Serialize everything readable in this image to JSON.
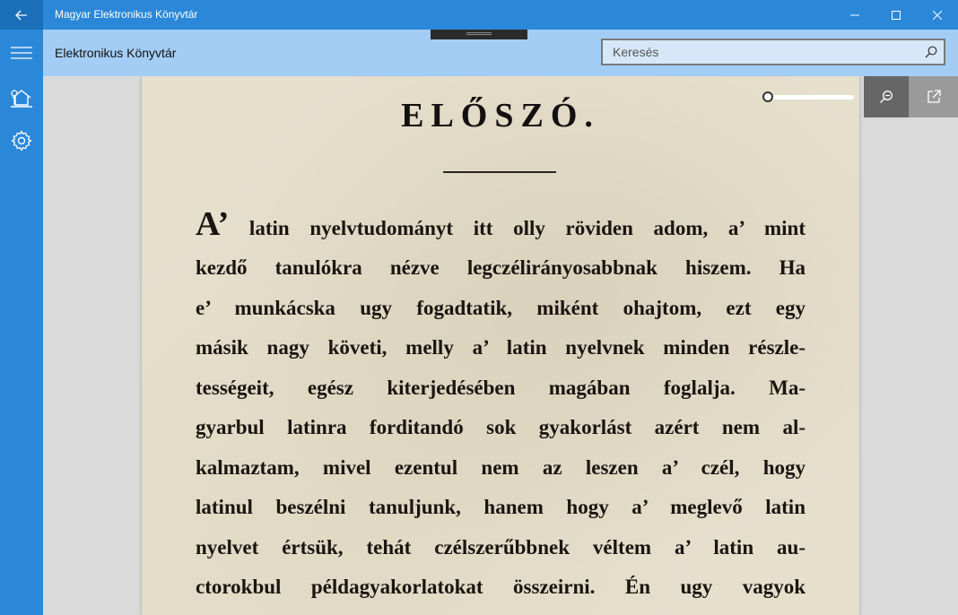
{
  "window": {
    "app_title": "Magyar Elektronikus Könyvtár",
    "back_icon": "back-arrow-icon",
    "minimize_icon": "minimize-icon",
    "maximize_icon": "maximize-icon",
    "close_icon": "close-icon"
  },
  "header": {
    "menu_icon": "hamburger-icon",
    "title": "Elektronikus Könyvtár",
    "search": {
      "placeholder": "Keresés",
      "value": ""
    },
    "search_icon": "search-icon"
  },
  "sidebar": {
    "items": [
      {
        "name": "home",
        "icon": "home-icon"
      },
      {
        "name": "settings",
        "icon": "gear-icon"
      }
    ]
  },
  "viewer": {
    "zoom_level": 0.0,
    "zoom_out_icon": "zoom-out-icon",
    "open_external_icon": "open-external-icon"
  },
  "page": {
    "heading": "ELŐSZÓ.",
    "drop_cap": "A’",
    "first_line_rest": " latin nyelvtudományt itt olly röviden adom, a’ mint",
    "lines": [
      "kezdő tanulókra nézve legczélirányosabbnak hiszem. Ha",
      "e’ munkácska ugy fogadtatik, miként ohajtom, ezt egy",
      "másik nagy követi, melly a’ latin nyelvnek minden részle-",
      "tességeit, egész kiterjedésében magában foglalja. Ma-",
      "gyarbul latinra forditandó sok gyakorlást azért nem al-",
      "kalmaztam, mivel ezentul nem az leszen a’ czél, hogy",
      "latinul beszélni tanuljunk, hanem hogy a’ meglevő latin",
      "nyelvet értsük, tehát czélszerűbbnek véltem a’ latin au-",
      "ctorokbul példagyakorlatokat összeirni. Én ugy vagyok"
    ]
  },
  "colors": {
    "accent": "#2b88d8",
    "header_bg": "#a3cdf5",
    "paper": "#e6dfcc"
  }
}
